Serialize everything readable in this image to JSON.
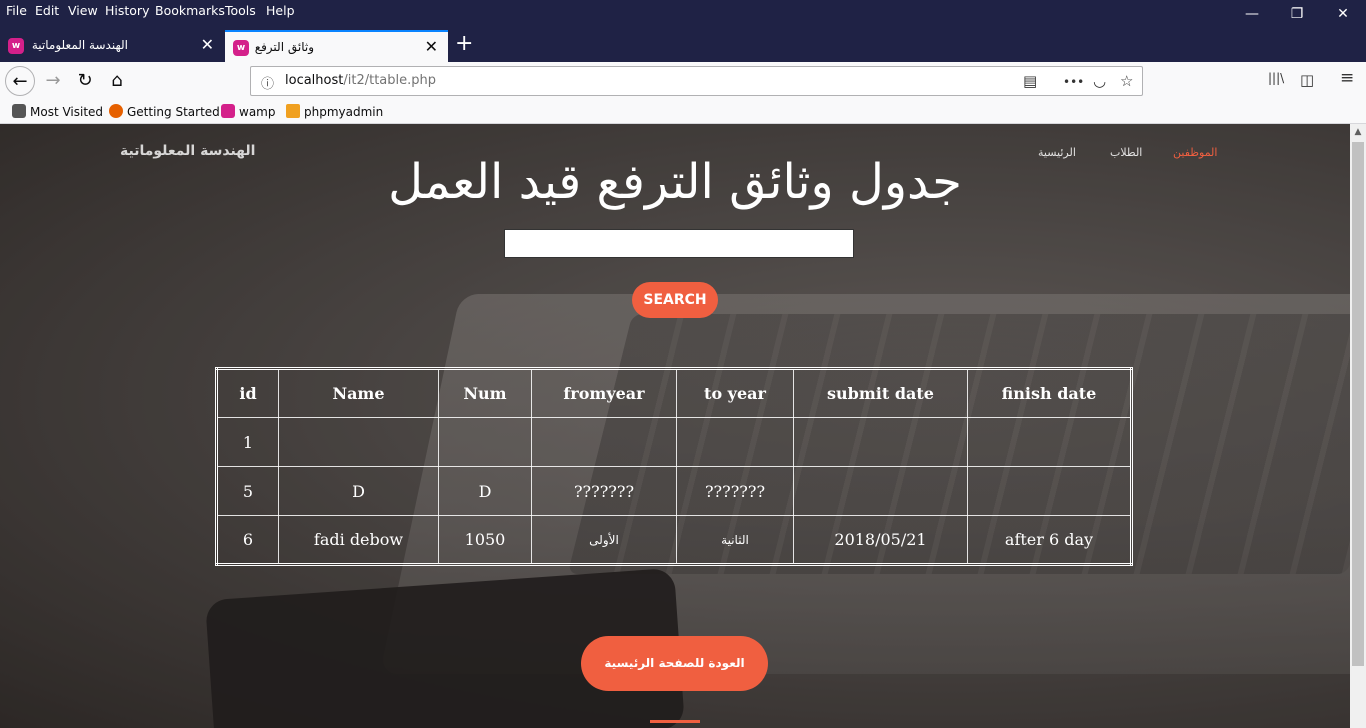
{
  "menu": [
    "File",
    "Edit",
    "View",
    "History",
    "Bookmarks",
    "Tools",
    "Help"
  ],
  "window_controls": {
    "minimize": "—",
    "restore": "❐",
    "close": "✕"
  },
  "tabs": [
    {
      "title": "الهندسة المعلوماتية",
      "close": "✕",
      "active": false
    },
    {
      "title": "وثائق الترفع",
      "close": "✕",
      "active": true
    }
  ],
  "newtab": "+",
  "nav": {
    "back": "←",
    "forward": "→",
    "reload": "↻",
    "home": "⌂"
  },
  "url": {
    "host": "localhost",
    "path": "/it2/ttable.php",
    "info": "ⓘ"
  },
  "url_icons": {
    "reader": "▤",
    "more": "•••",
    "pocket": "◡",
    "star": "☆"
  },
  "toolbar_icons": {
    "library": "|||\\",
    "sidebar": "◫",
    "menu": "≡"
  },
  "bookmarks": [
    {
      "label": "Most Visited",
      "icon": "gear-icon",
      "color": "#555555"
    },
    {
      "label": "Getting Started",
      "icon": "firefox-icon",
      "color": "#e66000"
    },
    {
      "label": "wamp",
      "icon": "wamp-icon",
      "color": "#d4208a"
    },
    {
      "label": "phpmyadmin",
      "icon": "phpmyadmin-icon",
      "color": "#f0a020"
    }
  ],
  "site": {
    "brand": "الهندسة المعلوماتية",
    "nav": [
      "الموظفين",
      "الطلاب",
      "الرئيسية"
    ],
    "title": "جدول وثائق الترفع قيد العمل",
    "search_value": "",
    "search_button": "SEARCH",
    "back_button": "العودة للصفحة الرئيسية",
    "accent": "#f05f40"
  },
  "table": {
    "headers": [
      "id",
      "Name",
      "Num",
      "fromyear",
      "to year",
      "submit date",
      "finish date"
    ],
    "rows": [
      [
        "1",
        "",
        "",
        "",
        "",
        "",
        ""
      ],
      [
        "5",
        "D",
        "D",
        "???????",
        "???????",
        "",
        ""
      ],
      [
        "6",
        "fadi debow",
        "1050",
        "الأولى",
        "الثانية",
        "2018/05/21",
        "after 6 day"
      ]
    ]
  }
}
